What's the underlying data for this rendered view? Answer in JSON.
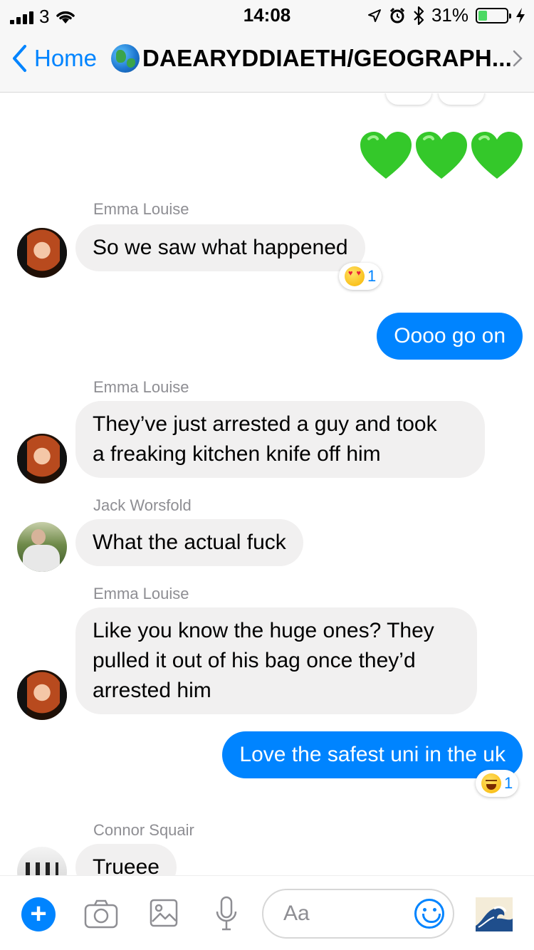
{
  "status_bar": {
    "carrier": "3",
    "time": "14:08",
    "battery_percent": "31%",
    "battery_level": 0.31
  },
  "nav": {
    "back_label": "Home",
    "title": "DAEARYDDIAETH/GEOGRAPH..."
  },
  "messages": {
    "m1": {
      "sender": "Emma Louise",
      "text": "So we saw what happened",
      "reaction_count": "1",
      "reaction_icon": "heart-eyes-emoji"
    },
    "m2": {
      "text": "Oooo go on"
    },
    "m3": {
      "sender": "Emma Louise",
      "line1": "They’ve just arrested a guy and took",
      "line2": "a freaking kitchen knife off him"
    },
    "m4": {
      "sender": "Jack Worsfold",
      "text": "What the actual fuck"
    },
    "m5": {
      "sender": "Emma Louise",
      "line1": "Like you know the huge ones? They",
      "line2": "pulled it out of his bag once they’d",
      "line3": "arrested him"
    },
    "m6": {
      "text": "Love the safest uni in the uk",
      "reaction_count": "1",
      "reaction_icon": "laughing-emoji"
    },
    "m7": {
      "sender": "Connor Squair",
      "text": "Trueee"
    }
  },
  "composer": {
    "placeholder": "Aa"
  },
  "colors": {
    "accent": "#0084ff",
    "incoming_bubble": "#f1f0f0",
    "heart": "#34c82a"
  }
}
